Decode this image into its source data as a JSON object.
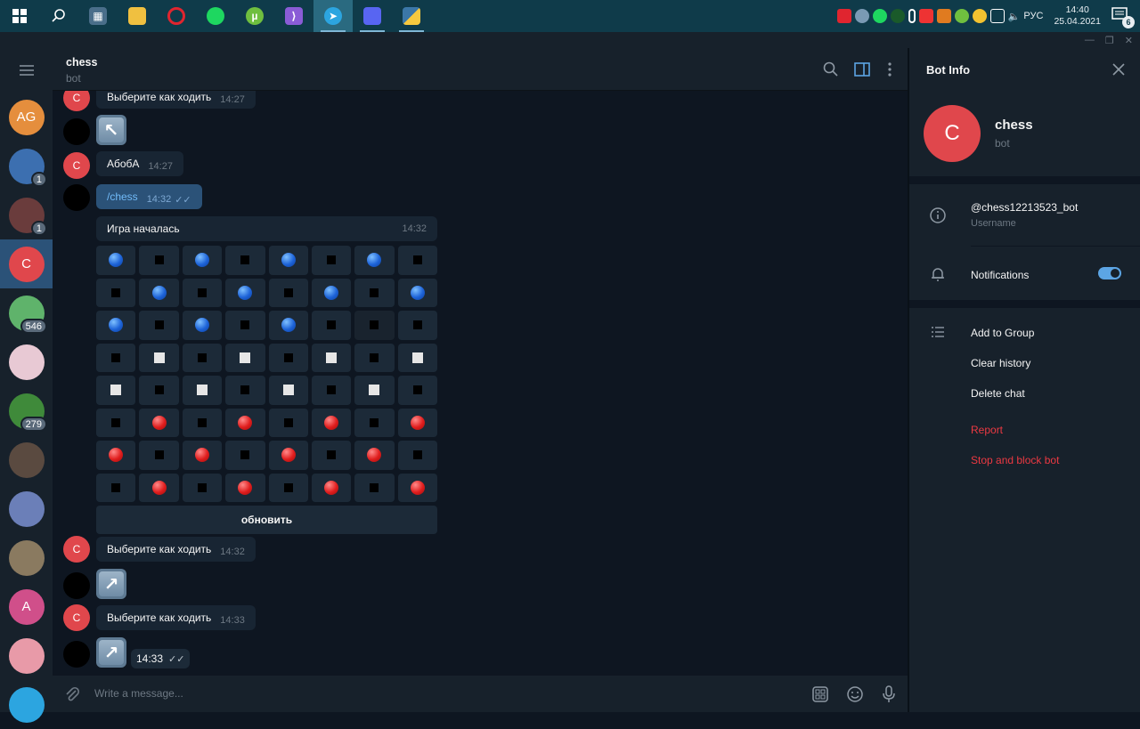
{
  "taskbar": {
    "apps": [
      {
        "name": "windows-start-icon"
      },
      {
        "name": "search-icon"
      },
      {
        "name": "calculator-icon"
      },
      {
        "name": "file-explorer-icon"
      },
      {
        "name": "opera-icon"
      },
      {
        "name": "spotify-icon"
      },
      {
        "name": "utorrent-icon"
      },
      {
        "name": "visual-studio-icon"
      },
      {
        "name": "telegram-icon"
      },
      {
        "name": "discord-icon"
      },
      {
        "name": "python-icon"
      }
    ],
    "language": "РУС",
    "time": "14:40",
    "date": "25.04.2021",
    "notification_count": "6"
  },
  "sidebar": {
    "chats": [
      {
        "initials": "AG",
        "color": "#e58e3d",
        "badge": ""
      },
      {
        "initials": "",
        "color": "#3c6fb0",
        "badge": "1"
      },
      {
        "initials": "",
        "color": "#6a3c3c",
        "badge": "1"
      },
      {
        "initials": "C",
        "color": "#e0474c",
        "badge": "",
        "selected": true
      },
      {
        "initials": "",
        "color": "#5fb36b",
        "badge": "546"
      },
      {
        "initials": "",
        "color": "#e8c9d4",
        "badge": ""
      },
      {
        "initials": "",
        "color": "#3f8a3a",
        "badge": "279"
      },
      {
        "initials": "",
        "color": "#5a4a40",
        "badge": ""
      },
      {
        "initials": "",
        "color": "#6b7fb8",
        "badge": ""
      },
      {
        "initials": "",
        "color": "#8a7a60",
        "badge": ""
      },
      {
        "initials": "A",
        "color": "#d04f8a",
        "badge": ""
      },
      {
        "initials": "",
        "color": "#e89aa8",
        "badge": ""
      },
      {
        "initials": "",
        "color": "#2ca5e0",
        "badge": ""
      }
    ]
  },
  "chat": {
    "title": "chess",
    "subtitle": "bot",
    "messages": {
      "m1_text": "Выберите как ходить",
      "m1_time": "14:27",
      "m2_sticker": "↖",
      "m3_text": "АбобА",
      "m3_time": "14:27",
      "m4_text": "/chess",
      "m4_time": "14:32",
      "board_title": "Игра началась",
      "board_time": "14:32",
      "refresh_label": "обновить",
      "m5_text": "Выберите как ходить",
      "m5_time": "14:32",
      "m6_sticker": "↗",
      "m7_text": "Выберите как ходить",
      "m7_time": "14:33",
      "m8_sticker": "↗",
      "m8_time": "14:33"
    },
    "board": [
      [
        "b",
        "k",
        "b",
        "k",
        "b",
        "k",
        "b",
        "k"
      ],
      [
        "k",
        "b",
        "k",
        "b",
        "k",
        "b",
        "k",
        "b"
      ],
      [
        "b",
        "k",
        "b",
        "k",
        "b",
        "k",
        "k",
        "k"
      ],
      [
        "k",
        "w",
        "k",
        "w",
        "k",
        "w",
        "k",
        "w"
      ],
      [
        "w",
        "k",
        "w",
        "k",
        "w",
        "k",
        "w",
        "k"
      ],
      [
        "k",
        "r",
        "k",
        "r",
        "k",
        "r",
        "k",
        "r"
      ],
      [
        "r",
        "k",
        "r",
        "k",
        "r",
        "k",
        "r",
        "k"
      ],
      [
        "k",
        "r",
        "k",
        "r",
        "k",
        "r",
        "k",
        "r"
      ]
    ],
    "input_placeholder": "Write a message..."
  },
  "info_panel": {
    "title": "Bot Info",
    "avatar_initial": "C",
    "name": "chess",
    "subtitle": "bot",
    "username": "@chess12213523_bot",
    "username_label": "Username",
    "notifications_label": "Notifications",
    "notifications_on": true,
    "actions": {
      "add_to_group": "Add to Group",
      "clear_history": "Clear history",
      "delete_chat": "Delete chat",
      "report": "Report",
      "stop_block": "Stop and block bot"
    }
  }
}
